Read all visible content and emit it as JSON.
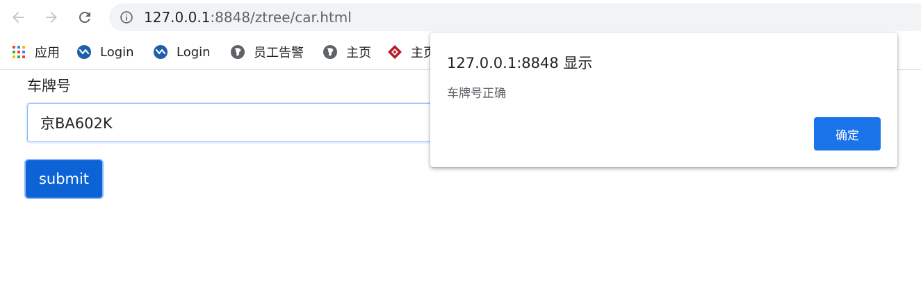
{
  "browser": {
    "url_host": "127.0.0.1",
    "url_rest": ":8848/ztree/car.html",
    "bookmarks": [
      {
        "label": "应用",
        "icon": "apps-grid-icon"
      },
      {
        "label": "Login",
        "icon": "login-logo-icon"
      },
      {
        "label": "Login",
        "icon": "login-logo-icon"
      },
      {
        "label": "员工告警",
        "icon": "globe-icon"
      },
      {
        "label": "主页",
        "icon": "globe-icon"
      },
      {
        "label": "主页",
        "icon": "red-diamond-icon"
      }
    ]
  },
  "form": {
    "label": "车牌号",
    "plate_value": "京BA602K",
    "submit_label": "submit"
  },
  "dialog": {
    "title": "127.0.0.1:8848 显示",
    "message": "车牌号正确",
    "ok_label": "确定"
  },
  "colors": {
    "primary_button": "#0b63d6",
    "dialog_ok": "#1a73e8",
    "omnibox_bg": "#f1f3f4"
  }
}
